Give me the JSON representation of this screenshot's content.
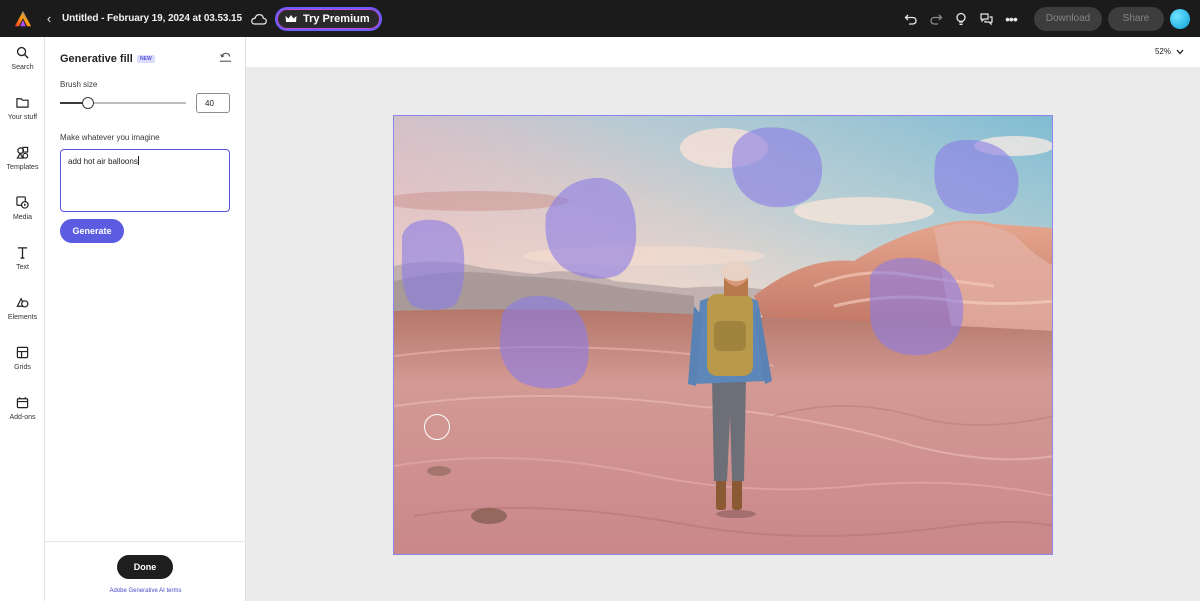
{
  "app": {
    "doc_title": "Untitled - February 19, 2024 at 03.53.15",
    "premium_label": "Try Premium",
    "download_label": "Download",
    "share_label": "Share"
  },
  "rail": {
    "items": [
      {
        "label": "Search",
        "icon": "search-icon"
      },
      {
        "label": "Your stuff",
        "icon": "folder-icon"
      },
      {
        "label": "Templates",
        "icon": "templates-icon"
      },
      {
        "label": "Media",
        "icon": "media-icon"
      },
      {
        "label": "Text",
        "icon": "text-icon"
      },
      {
        "label": "Elements",
        "icon": "elements-icon"
      },
      {
        "label": "Grids",
        "icon": "grids-icon"
      },
      {
        "label": "Add-ons",
        "icon": "addons-icon"
      }
    ]
  },
  "panel": {
    "title": "Generative fill",
    "badge": "NEW",
    "brush_label": "Brush size",
    "brush_value": "40",
    "brush_level": 0.22,
    "prompt_label": "Make whatever you imagine",
    "prompt_value": "add hot air balloons",
    "generate_label": "Generate",
    "done_label": "Done",
    "terms_label": "Adobe Generative AI terms"
  },
  "canvas": {
    "zoom": "52%"
  },
  "colors": {
    "accent": "#5b5ce0",
    "topbar": "#1b1b1b",
    "mask": "#8a7be6"
  }
}
